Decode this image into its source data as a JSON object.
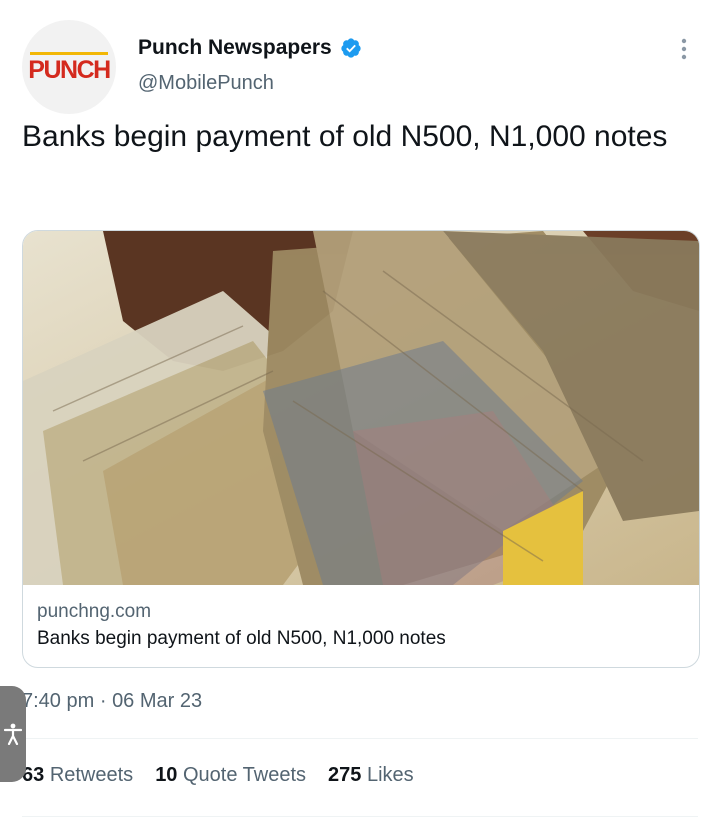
{
  "author": {
    "logo_text": "PUNCH",
    "name": "Punch Newspapers",
    "handle": "@MobilePunch",
    "verified_icon": "verified-badge-icon",
    "verified_color": "#1d9bf0",
    "logo_color": "#d42a1e",
    "logo_bar_color": "#f2b705"
  },
  "menu": {
    "icon": "more-vertical-icon"
  },
  "tweet": {
    "text": "Banks begin payment of old N500, N1,000 notes"
  },
  "card": {
    "image_description_icon": "naira-notes-photo",
    "domain": "punchng.com",
    "title": "Banks begin payment of old N500, N1,000 notes"
  },
  "meta": {
    "time": "7:40 pm",
    "separator": "·",
    "date": "06 Mar 23"
  },
  "stats": {
    "retweets_count": "63",
    "retweets_label": "Retweets",
    "quotes_count": "10",
    "quotes_label": "Quote Tweets",
    "likes_count": "275",
    "likes_label": "Likes"
  },
  "accessibility": {
    "icon": "accessibility-icon",
    "color": "#7a7a7a"
  }
}
